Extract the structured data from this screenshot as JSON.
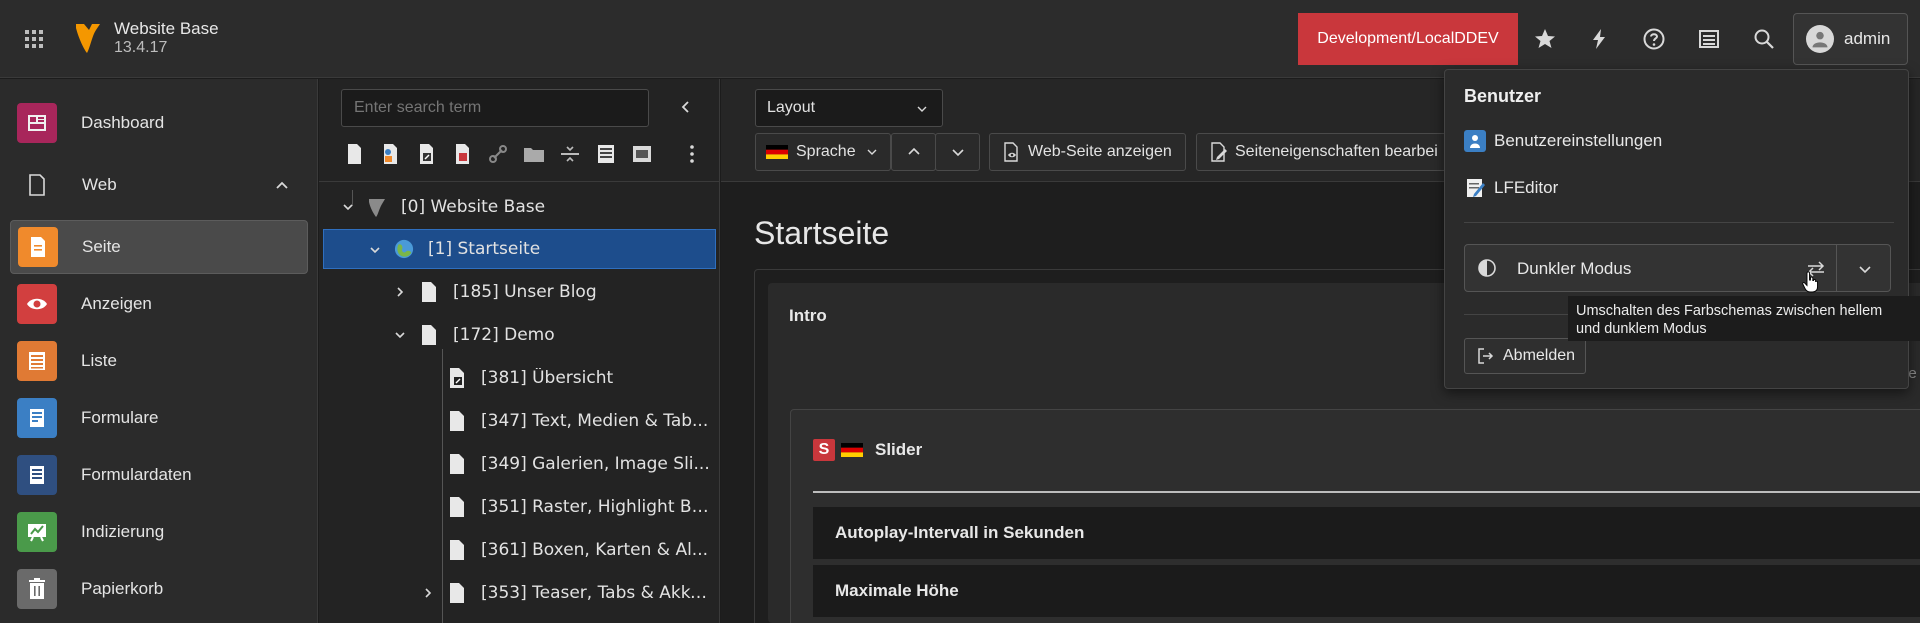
{
  "topbar": {
    "site_name": "Website Base",
    "site_version": "13.4.17",
    "environment": "Development/LocalDDEV",
    "user_name": "admin",
    "icons": [
      "grid-icon",
      "star-icon",
      "bolt-icon",
      "help-icon",
      "list-icon",
      "search-icon",
      "user-icon"
    ],
    "env_color": "#c9373c"
  },
  "modules": {
    "dashboard": "Dashboard",
    "web": "Web",
    "items": [
      {
        "label": "Seite",
        "color": "#f08a2c",
        "icon": "page-icon"
      },
      {
        "label": "Anzeigen",
        "color": "#d23f3f",
        "icon": "eye-icon"
      },
      {
        "label": "Liste",
        "color": "#e07a34",
        "icon": "list-icon"
      },
      {
        "label": "Formulare",
        "color": "#3b7fc4",
        "icon": "form-icon"
      },
      {
        "label": "Formulardaten",
        "color": "#2f4f80",
        "icon": "formdata-icon"
      },
      {
        "label": "Indizierung",
        "color": "#4a9a4a",
        "icon": "chart-icon"
      },
      {
        "label": "Papierkorb",
        "color": "#6a6a6a",
        "icon": "trash-icon"
      }
    ]
  },
  "tree": {
    "search_placeholder": "Enter search term",
    "rows": [
      {
        "text": "[0] Website Base"
      },
      {
        "text": "[1] Startseite"
      },
      {
        "text": "[185] Unser Blog"
      },
      {
        "text": "[172] Demo"
      },
      {
        "text": "[381] Übersicht"
      },
      {
        "text": "[347] Text, Medien & Tab..."
      },
      {
        "text": "[349] Galerien, Image Sli..."
      },
      {
        "text": "[351] Raster, Highlight Bo..."
      },
      {
        "text": "[361] Boxen, Karten & Al..."
      },
      {
        "text": "[353] Teaser, Tabs & Akko..."
      }
    ]
  },
  "main": {
    "layout_select": "Layout",
    "language_button": "Sprache",
    "view_button": "Web-Seite anzeigen",
    "props_button": "Seiteneigenschaften bearbei",
    "page_title": "Startseite",
    "intro": "Intro",
    "slider_badge": "S",
    "slider_title": "Slider",
    "fields": [
      "Autoplay-Intervall in Sekunden",
      "Maximale Höhe"
    ],
    "cutoff": "le"
  },
  "user_menu": {
    "title": "Benutzer",
    "settings": "Benutzereinstellungen",
    "lfeditor": "LFEditor",
    "dark_mode": "Dunkler Modus",
    "tooltip_line1": "Umschalten des Farbschemas zwischen hellem",
    "tooltip_line2": "und dunklem Modus",
    "logout": "Abmelden"
  }
}
